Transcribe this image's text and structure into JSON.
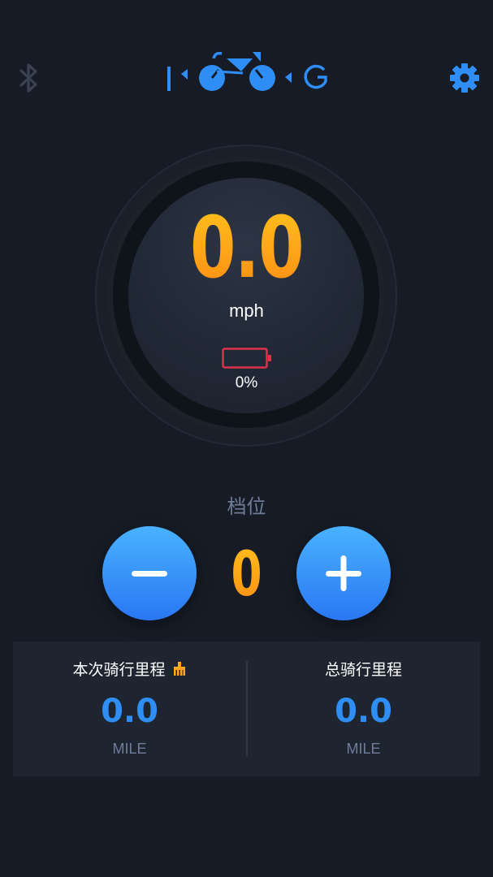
{
  "header": {
    "bluetooth_icon": "bluetooth-icon",
    "logo_icon": "bike-logo-icon",
    "settings_icon": "gear-icon"
  },
  "speedometer": {
    "speed": "0.0",
    "unit": "mph",
    "battery_icon": "battery-icon",
    "battery_percent": "0%",
    "battery_color": "#e0314b"
  },
  "gear_control": {
    "label": "档位",
    "value": "0",
    "minus_icon": "minus-icon",
    "plus_icon": "plus-icon"
  },
  "mileage": {
    "trip": {
      "title": "本次骑行里程",
      "clear_icon": "broom-icon",
      "value": "0.0",
      "unit": "MILE"
    },
    "total": {
      "title": "总骑行里程",
      "value": "0.0",
      "unit": "MILE"
    }
  },
  "colors": {
    "background": "#161b25",
    "accent_blue": "#2f8ef5",
    "accent_orange": "#ff9f18",
    "panel": "#1e2430"
  }
}
